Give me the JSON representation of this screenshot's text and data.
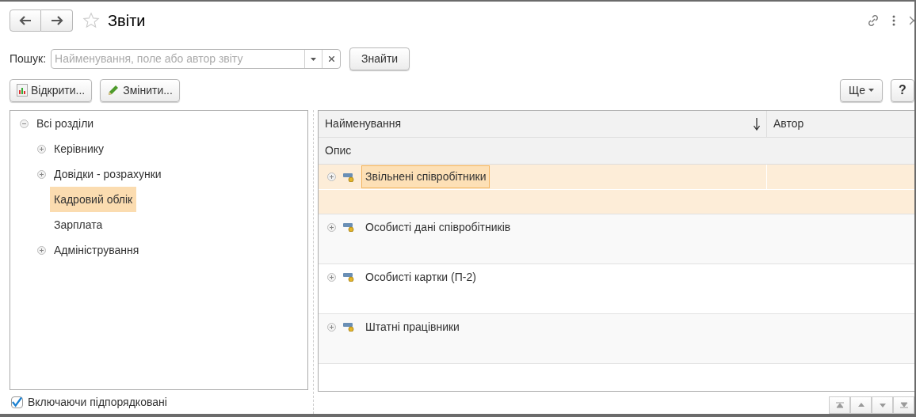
{
  "window": {
    "title": "Звіти",
    "favorite": false
  },
  "search": {
    "label": "Пошук:",
    "placeholder": "Найменування, поле або автор звіту",
    "button": "Знайти"
  },
  "toolbar": {
    "open_button": "Відкрити...",
    "edit_button": "Змінити...",
    "more_button": "Ще",
    "help_button": "?"
  },
  "sections": [
    {
      "label": "Всі розділи",
      "expanded": true,
      "selected": false,
      "children": [
        {
          "label": "Керівнику",
          "expanded": false,
          "selected": false
        },
        {
          "label": "Довідки - розрахунки",
          "expanded": false,
          "selected": false
        },
        {
          "label": "Кадровий облік",
          "selected": true
        },
        {
          "label": "Зарплата",
          "selected": false
        },
        {
          "label": "Адміністрування",
          "expanded": false,
          "selected": false
        }
      ]
    }
  ],
  "table": {
    "columns": [
      {
        "label": "Найменування",
        "sorted": true
      },
      {
        "label": "Автор",
        "sorted": false
      }
    ],
    "subheader": "Опис",
    "rows": [
      {
        "name": "Звільнені співробітники",
        "selected": true
      },
      {
        "name": "Особисті дані співробітників",
        "selected": false
      },
      {
        "name": "Особисті картки (П-2)",
        "selected": false
      },
      {
        "name": "Штатні працівники",
        "selected": false
      }
    ]
  },
  "include_subordinate": {
    "label": "Включаючи підпорядковані",
    "checked": true
  }
}
